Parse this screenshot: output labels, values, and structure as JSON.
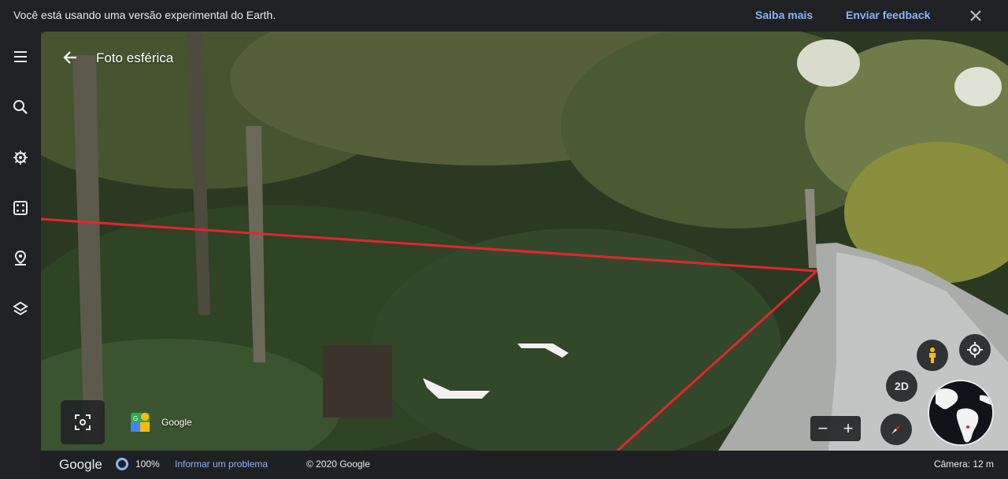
{
  "banner": {
    "message": "Você está usando uma versão experimental do Earth.",
    "learn_more": "Saiba mais",
    "send_feedback": "Enviar feedback",
    "close_icon": "close-icon"
  },
  "rail": {
    "items": [
      {
        "icon": "menu-icon"
      },
      {
        "icon": "search-icon"
      },
      {
        "icon": "voyager-icon"
      },
      {
        "icon": "feeling-lucky-icon"
      },
      {
        "icon": "projects-icon"
      },
      {
        "icon": "map-style-icon"
      }
    ]
  },
  "photo": {
    "title": "Foto esférica",
    "back_icon": "arrow-back-icon",
    "contributor": "Google"
  },
  "controls": {
    "mode_2d": "2D",
    "zoom_minus": "−",
    "zoom_plus": "+"
  },
  "statusbar": {
    "logo": "Google",
    "progress": "100%",
    "report": "Informar um problema",
    "copyright": "© 2020 Google",
    "camera": "Câmera: 12 m"
  },
  "colors": {
    "accent": "#8ab4f8",
    "line": "#e3262f",
    "bg": "#202124"
  }
}
